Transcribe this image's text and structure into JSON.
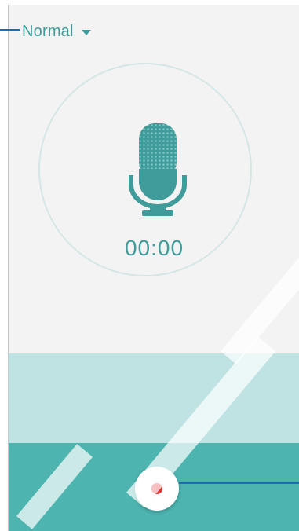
{
  "mode_selector": {
    "label": "Normal",
    "icon": "caret-down-icon"
  },
  "recorder": {
    "timer": "00:00",
    "mic_icon": "microphone-icon"
  },
  "controls": {
    "record_icon": "record-icon"
  },
  "colors": {
    "accent": "#3f9c9a",
    "panel_light": "#bfe3e3",
    "panel_dark": "#4db4b0",
    "record_red": "#e03030",
    "callout_line": "#1d6bb2",
    "background": "#f3f3f3"
  }
}
